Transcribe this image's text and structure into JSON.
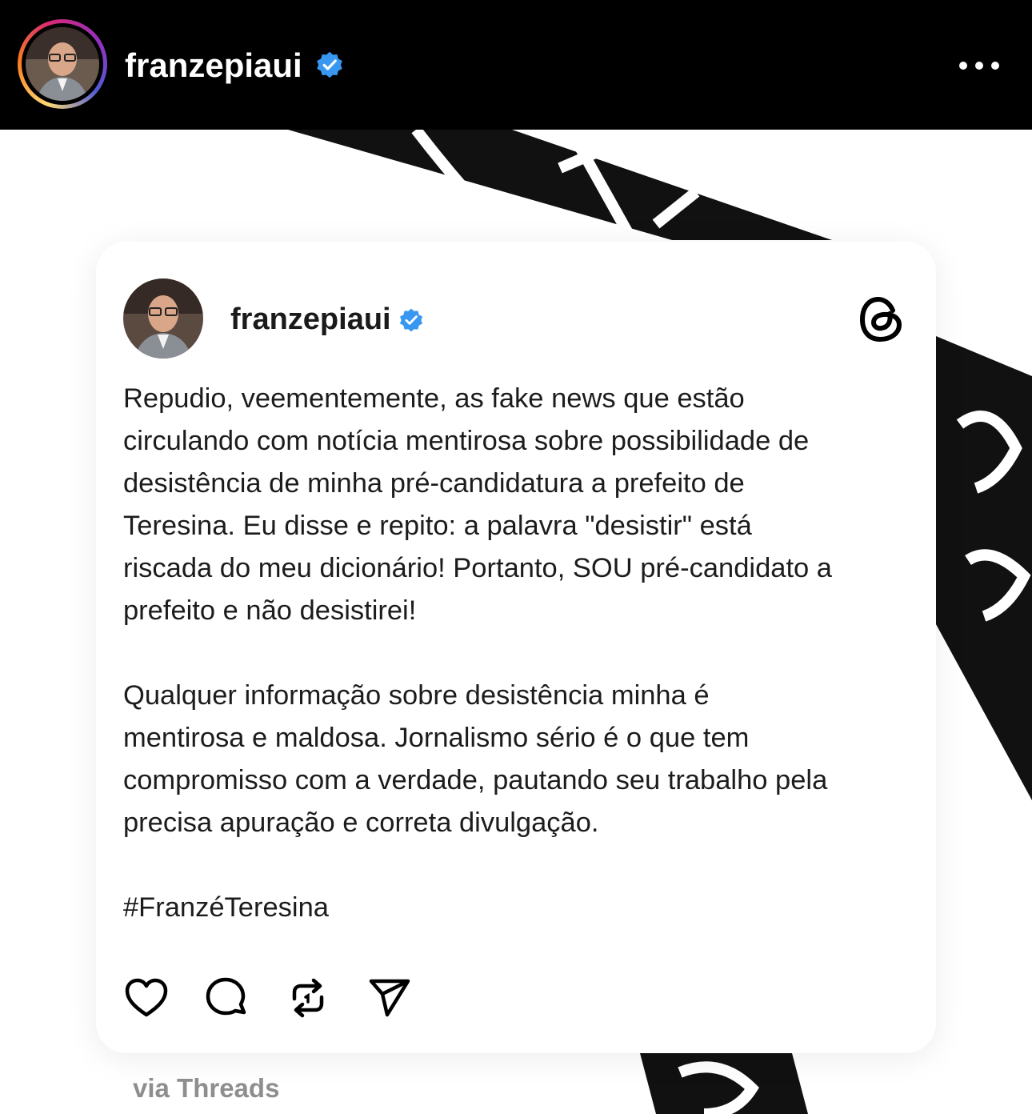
{
  "header": {
    "username": "franzepiaui",
    "verified_icon": "verified-badge-icon",
    "more_icon": "more-horizontal-icon"
  },
  "post_card": {
    "username": "franzepiaui",
    "verified_icon": "verified-badge-icon",
    "logo_icon": "threads-logo-icon",
    "paragraph_1": "Repudio, veementemente, as fake news que estão\ncirculando com notícia mentirosa sobre possibilidade de\ndesistência de minha pré-candidatura a prefeito de\nTeresina. Eu disse e repito: a palavra \"desistir\" está\nriscada do meu dicionário! Portanto, SOU pré-candidato a\nprefeito e não desistirei!",
    "paragraph_2": "Qualquer informação sobre desistência minha é\nmentirosa e maldosa. Jornalismo sério é o que tem\ncompromisso com a verdade, pautando seu trabalho pela\nprecisa apuração e correta divulgação.",
    "hashtag": "#FranzéTeresina",
    "actions": [
      "heart-icon",
      "comment-icon",
      "repost-icon",
      "share-icon"
    ]
  },
  "footer": {
    "via_label": "via Threads"
  },
  "colors": {
    "verified": "#3897f0",
    "header_bg": "#000000",
    "text": "#1c1c1c",
    "muted": "#8e8e8e"
  }
}
